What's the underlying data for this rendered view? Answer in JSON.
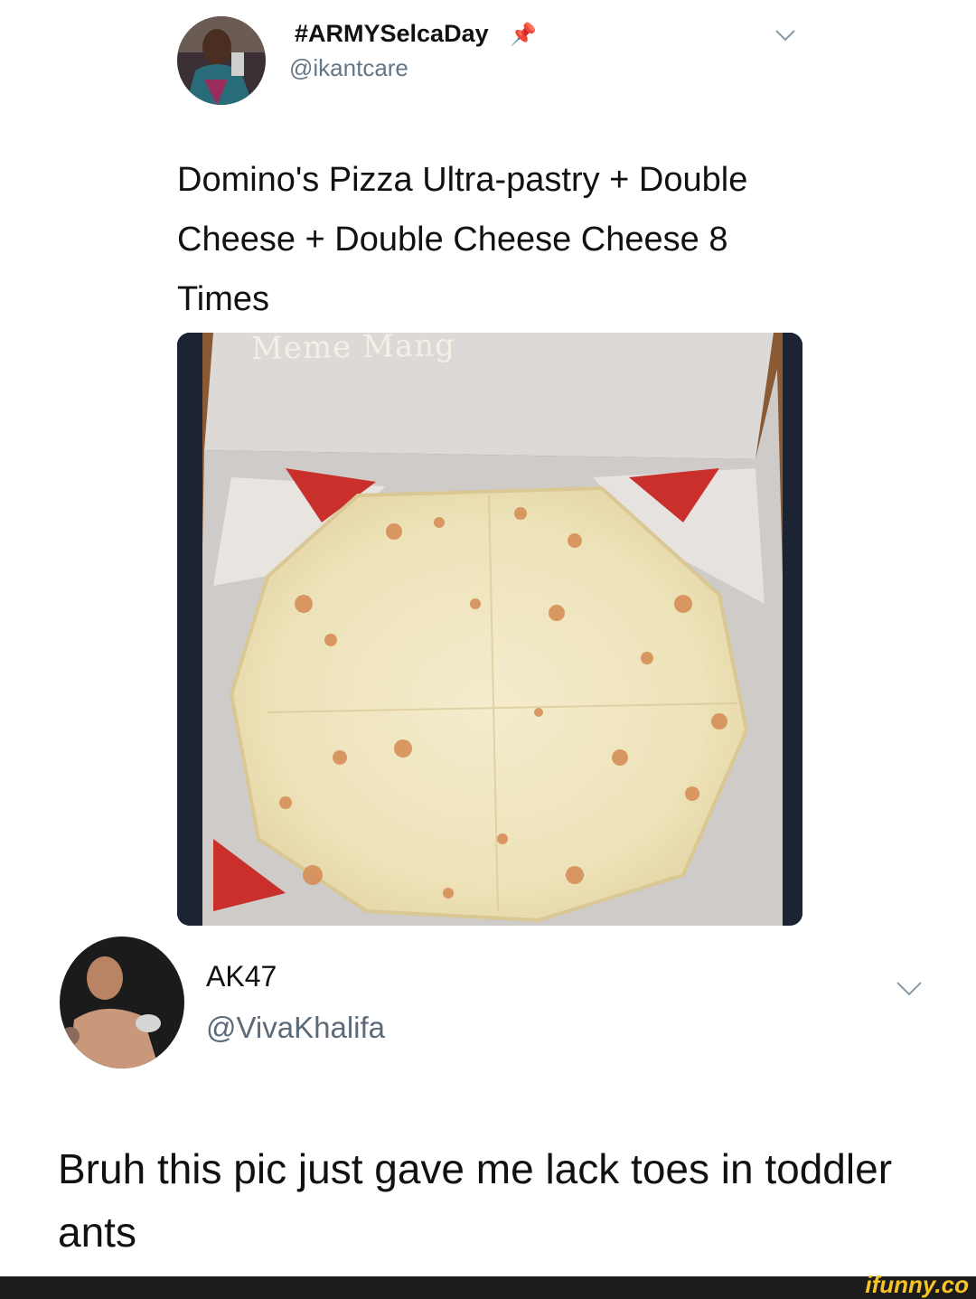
{
  "tweet1": {
    "display_name": "#ARMYSelcaDay",
    "pin_icon": "pushpin-icon",
    "handle": "@ikantcare",
    "text": "Domino's Pizza Ultra-pastry + Double Cheese + Double Cheese Cheese 8 Times",
    "image_watermark": "Meme Mang"
  },
  "tweet2": {
    "display_name": "AK47",
    "handle": "@VivaKhalifa",
    "text": "Bruh this pic just gave me lack toes in toddler ants"
  },
  "footer": {
    "brand": "ifunny.co"
  },
  "colors": {
    "handle": "#657786",
    "brand": "#f7c325",
    "pin": "#d43a3a"
  }
}
